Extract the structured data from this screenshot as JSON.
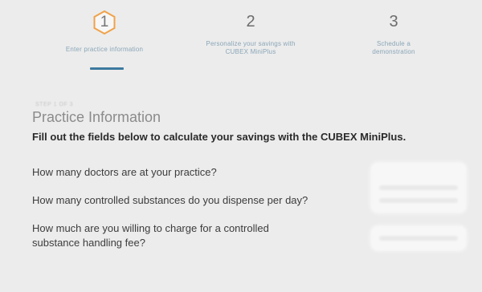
{
  "stepper": {
    "steps": [
      {
        "number": "1",
        "label_line1": "Enter practice information",
        "label_line2": "",
        "active": true
      },
      {
        "number": "2",
        "label_line1": "Personalize your savings with",
        "label_line2": "CUBEX MiniPlus",
        "active": false
      },
      {
        "number": "3",
        "label_line1": "Schedule a",
        "label_line2": "demonstration",
        "active": false
      }
    ],
    "colors": {
      "active_bar": "#3c7a9e",
      "hex_outline": "#f0a24a"
    }
  },
  "section": {
    "kicker": "STEP 1 OF 3",
    "title": "Practice Information",
    "subtitle": "Fill out the fields below to calculate your savings with the CUBEX MiniPlus."
  },
  "questions": [
    "How many doctors are at your practice?",
    "How many controlled substances do you dispense per day?",
    "How much are you willing to charge for a controlled substance handling fee?"
  ]
}
